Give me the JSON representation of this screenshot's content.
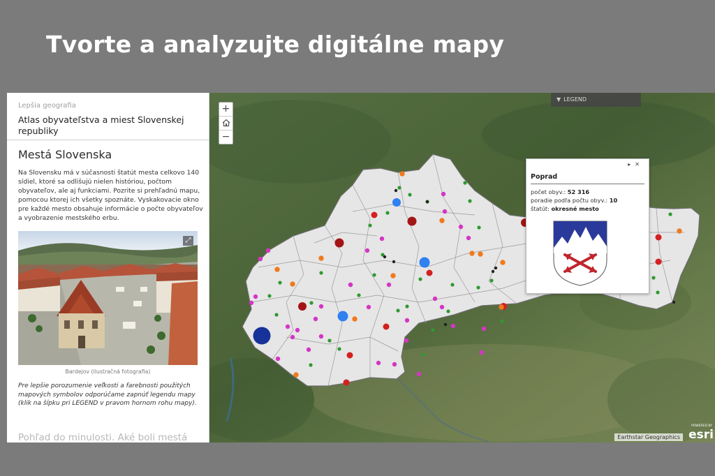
{
  "slide": {
    "title": "Tvorte a analyzujte digitálne mapy"
  },
  "panel": {
    "brand": "Lepšia geografia",
    "story_title": "Atlas obyvateľstva a miest Slovenskej republiky",
    "section_heading": "Mestá Slovenska",
    "intro": "Na Slovensku má v súčasnosti štatút mesta celkovo 140 sídiel, ktoré sa odlišujú nielen históriou, počtom obyvateľov, ale aj funkciami. Pozrite si prehľadnú mapu, pomocou ktorej ich všetky spoznáte. Vyskakovacie okno pre každé mesto obsahuje informácie o počte obyvateľov a vyobrazenie mestského erbu.",
    "image_caption": "Bardejov (ilustračná fotografia)",
    "legend_note": "Pre lepšie porozumenie veľkosti a farebnosti použitých mapových symbolov odporúčame zapnúť legendu mapy (klik na šípku pri LEGEND v pravom hornom rohu mapy).",
    "next_heading": "Pohľad do minulosti. Aké boli mestá"
  },
  "map": {
    "zoom_in": "+",
    "home_icon": "home-icon",
    "zoom_out": "−",
    "legend_label": "LEGEND",
    "attribution": "Earthstar Geographics",
    "esri_powered": "POWERED BY",
    "esri_logo": "esri",
    "colors": {
      "red": "#d42020",
      "dark_red": "#a31515",
      "magenta": "#d535c4",
      "orange": "#f07a1e",
      "green": "#2f9a2f",
      "black": "#222222",
      "blue": "#2f80f0",
      "navy": "#17339a"
    }
  },
  "popup": {
    "title": "Poprad",
    "rows": [
      {
        "label": "počet obyv.:",
        "value": "52 316"
      },
      {
        "label": "poradie podľa počtu obyv.:",
        "value": "10"
      },
      {
        "label": "štatút:",
        "value": "okresné mesto"
      }
    ]
  }
}
